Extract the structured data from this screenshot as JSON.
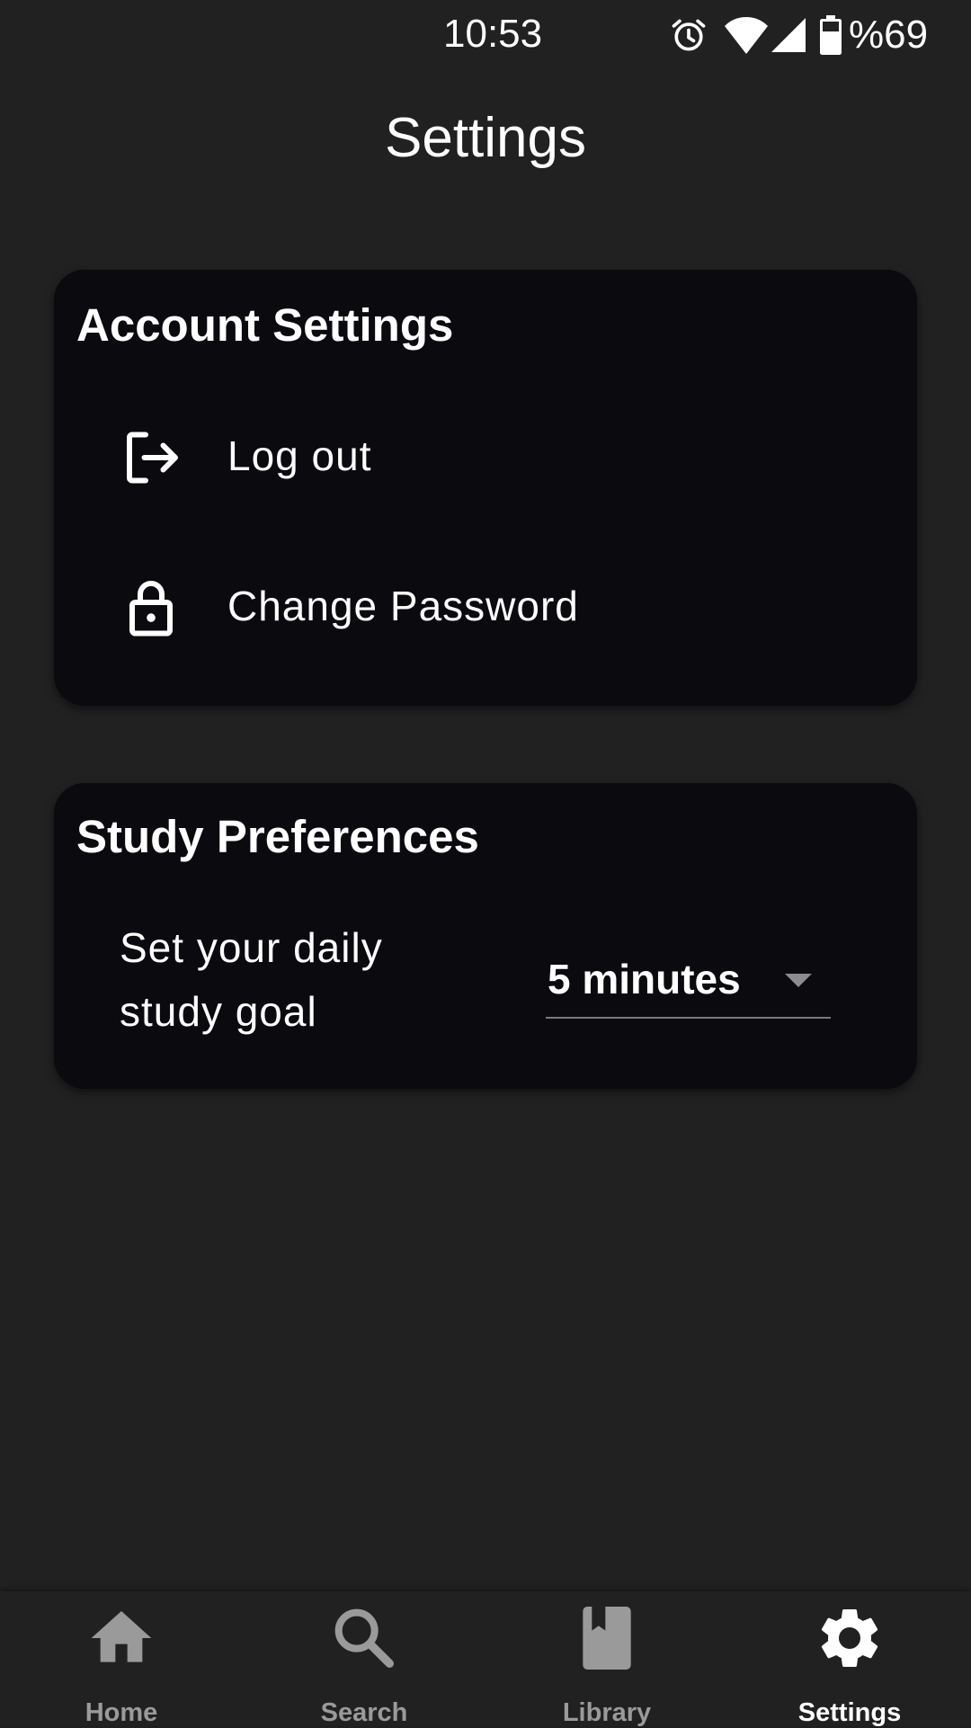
{
  "status_bar": {
    "time": "10:53",
    "battery": "%69",
    "icons": [
      "alarm-icon",
      "wifi-icon",
      "signal-icon",
      "battery-icon"
    ]
  },
  "page": {
    "title": "Settings"
  },
  "account_settings": {
    "heading": "Account Settings",
    "items": [
      {
        "label": "Log out",
        "icon": "logout-icon"
      },
      {
        "label": "Change Password",
        "icon": "lock-icon"
      }
    ]
  },
  "study_preferences": {
    "heading": "Study Preferences",
    "goal_label": "Set your daily study goal",
    "goal_value": "5 minutes"
  },
  "bottom_nav": {
    "items": [
      {
        "label": "Home",
        "icon": "home-icon",
        "active": false
      },
      {
        "label": "Search",
        "icon": "search-icon",
        "active": false
      },
      {
        "label": "Library",
        "icon": "book-icon",
        "active": false
      },
      {
        "label": "Settings",
        "icon": "gear-icon",
        "active": true
      }
    ]
  },
  "colors": {
    "background": "#212121",
    "card": "#0a0a0f",
    "text": "#ffffff",
    "inactive": "#9a9a9a"
  }
}
